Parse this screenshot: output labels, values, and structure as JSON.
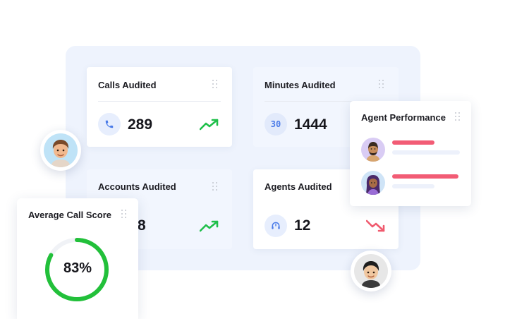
{
  "cards": {
    "calls": {
      "title": "Calls Audited",
      "value": "289",
      "trend": "up"
    },
    "minutes": {
      "title": "Minutes Audited",
      "value": "1444",
      "icon_text": "30"
    },
    "accounts": {
      "title": "Accounts Audited",
      "value": "8",
      "trend": "up"
    },
    "agents": {
      "title": "Agents Audited",
      "value": "12",
      "trend": "down"
    }
  },
  "agent_performance": {
    "title": "Agent Performance",
    "rows": [
      {
        "score_fraction": 0.63
      },
      {
        "score_fraction": 0.98
      }
    ]
  },
  "average_call_score": {
    "title": "Average Call Score",
    "value_text": "83%",
    "value": 0.83
  },
  "colors": {
    "accent_blue": "#4a7be8",
    "trend_up": "#1fbf4a",
    "trend_down": "#f05a6e",
    "progress": "#22c03a",
    "performance_bar": "#f25c75",
    "panel_bg": "#eef3fd"
  },
  "icons": [
    "phone-icon",
    "timer-icon",
    "headset-icon",
    "trend-up-icon",
    "trend-down-icon",
    "drag-handle-icon"
  ]
}
